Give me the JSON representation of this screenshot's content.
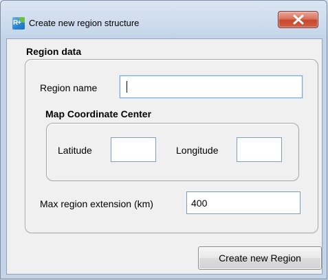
{
  "window": {
    "title": "Create new region structure",
    "icon": "rplus-app-icon",
    "close_icon": "close-icon"
  },
  "region_data": {
    "label": "Region data",
    "region_name": {
      "label": "Region name",
      "value": ""
    },
    "map_center": {
      "label": "Map Coordinate Center",
      "latitude": {
        "label": "Latitude",
        "value": ""
      },
      "longitude": {
        "label": "Longitude",
        "value": ""
      }
    },
    "max_extension": {
      "label": "Max region extension (km)",
      "value": "400"
    }
  },
  "actions": {
    "create_label": "Create new Region"
  },
  "colors": {
    "close_button": "#c6472b",
    "frame": "#c4d3e5",
    "client_background": "#f0f0f0",
    "input_focus_border": "#76a8d8"
  }
}
